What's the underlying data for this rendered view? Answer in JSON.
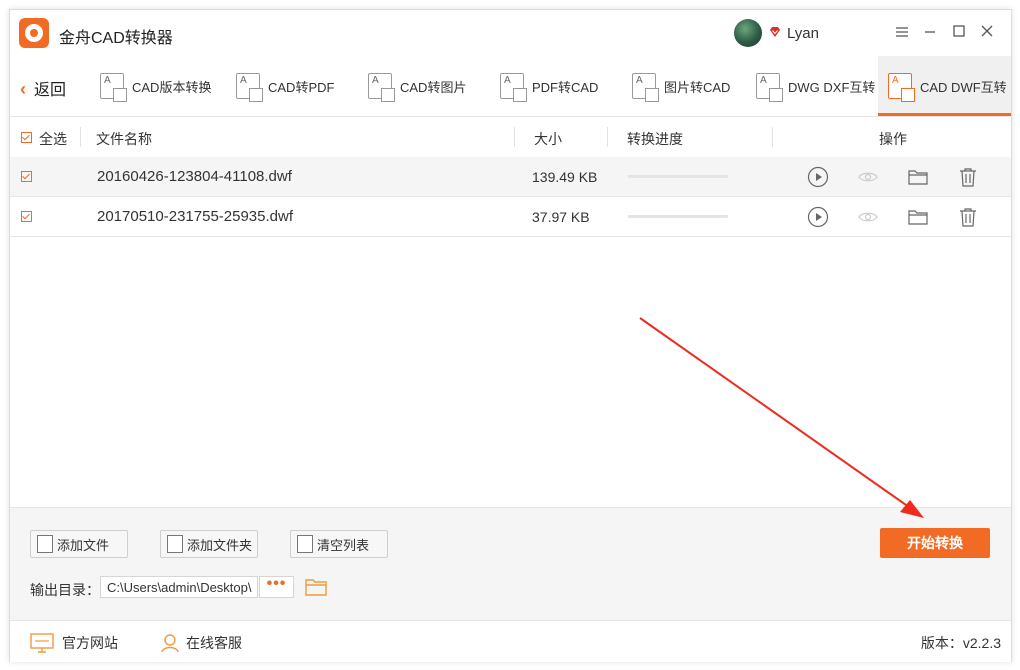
{
  "app": {
    "title": "金舟CAD转换器",
    "username": "Lyan",
    "window_controls": [
      "menu-icon",
      "minimize-icon",
      "maximize-icon",
      "close-icon"
    ]
  },
  "toolbar": {
    "back_label": "返回",
    "tools": [
      {
        "label": "CAD版本转换",
        "icon": "cad-version-icon"
      },
      {
        "label": "CAD转PDF",
        "icon": "cad-to-pdf-icon"
      },
      {
        "label": "CAD转图片",
        "icon": "cad-to-image-icon"
      },
      {
        "label": "PDF转CAD",
        "icon": "pdf-to-cad-icon"
      },
      {
        "label": "图片转CAD",
        "icon": "image-to-cad-icon"
      },
      {
        "label": "DWG DXF互转",
        "icon": "dwg-dxf-icon"
      },
      {
        "label": "CAD DWF互转",
        "icon": "cad-dwf-icon",
        "active": true
      }
    ],
    "accent_color": "#f26b24"
  },
  "table": {
    "select_all_label": "全选",
    "columns": {
      "name": "文件名称",
      "size": "大小",
      "progress": "转换进度",
      "actions": "操作"
    },
    "rows": [
      {
        "name": "20160426-123804-41108.dwf",
        "size": "139.49 KB",
        "progress": 0,
        "checked": true
      },
      {
        "name": "20170510-231755-25935.dwf",
        "size": "37.97 KB",
        "progress": 0,
        "checked": true
      }
    ],
    "row_action_icons": [
      "play-icon",
      "eye-icon",
      "folder-icon",
      "trash-icon"
    ]
  },
  "bottom": {
    "add_file_label": "添加文件",
    "add_folder_label": "添加文件夹",
    "clear_list_label": "清空列表",
    "start_label": "开始转换",
    "output_label": "输出目录：",
    "output_path": "C:\\Users\\admin\\Desktop\\",
    "browse_label": "•••"
  },
  "status": {
    "website_label": "官方网站",
    "support_label": "在线客服",
    "version_label": "版本：v2.2.3"
  }
}
